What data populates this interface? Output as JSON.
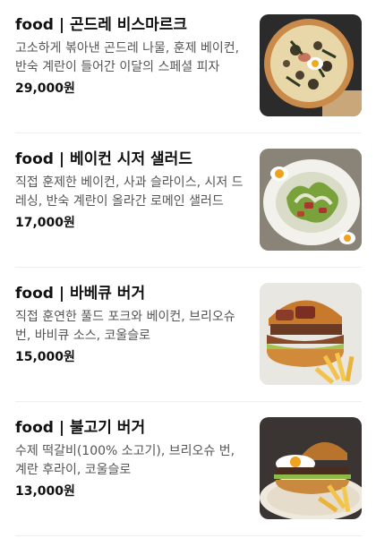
{
  "menu": {
    "items": [
      {
        "title": "food | 곤드레 비스마르크",
        "description": "고소하게 볶아낸 곤드레 나물, 훈제 베이컨, 반숙 계란이 들어간 이달의 스페셜 피자",
        "price": "29,000원",
        "image_icon": "pizza-photo"
      },
      {
        "title": "food | 베이컨 시저 샐러드",
        "description": "직접 훈제한 베이컨, 사과 슬라이스, 시저 드레싱, 반숙 계란이 올라간 로메인 샐러드",
        "price": "17,000원",
        "image_icon": "salad-photo"
      },
      {
        "title": "food | 바베큐 버거",
        "description": "직접 훈연한 풀드 포크와 베이컨, 브리오슈 번, 바비큐 소스, 코울슬로",
        "price": "15,000원",
        "image_icon": "burger-photo"
      },
      {
        "title": "food | 불고기 버거",
        "description": "수제 떡갈비(100% 소고기), 브리오슈 번, 계란 후라이, 코울슬로",
        "price": "13,000원",
        "image_icon": "burger-photo"
      }
    ]
  }
}
